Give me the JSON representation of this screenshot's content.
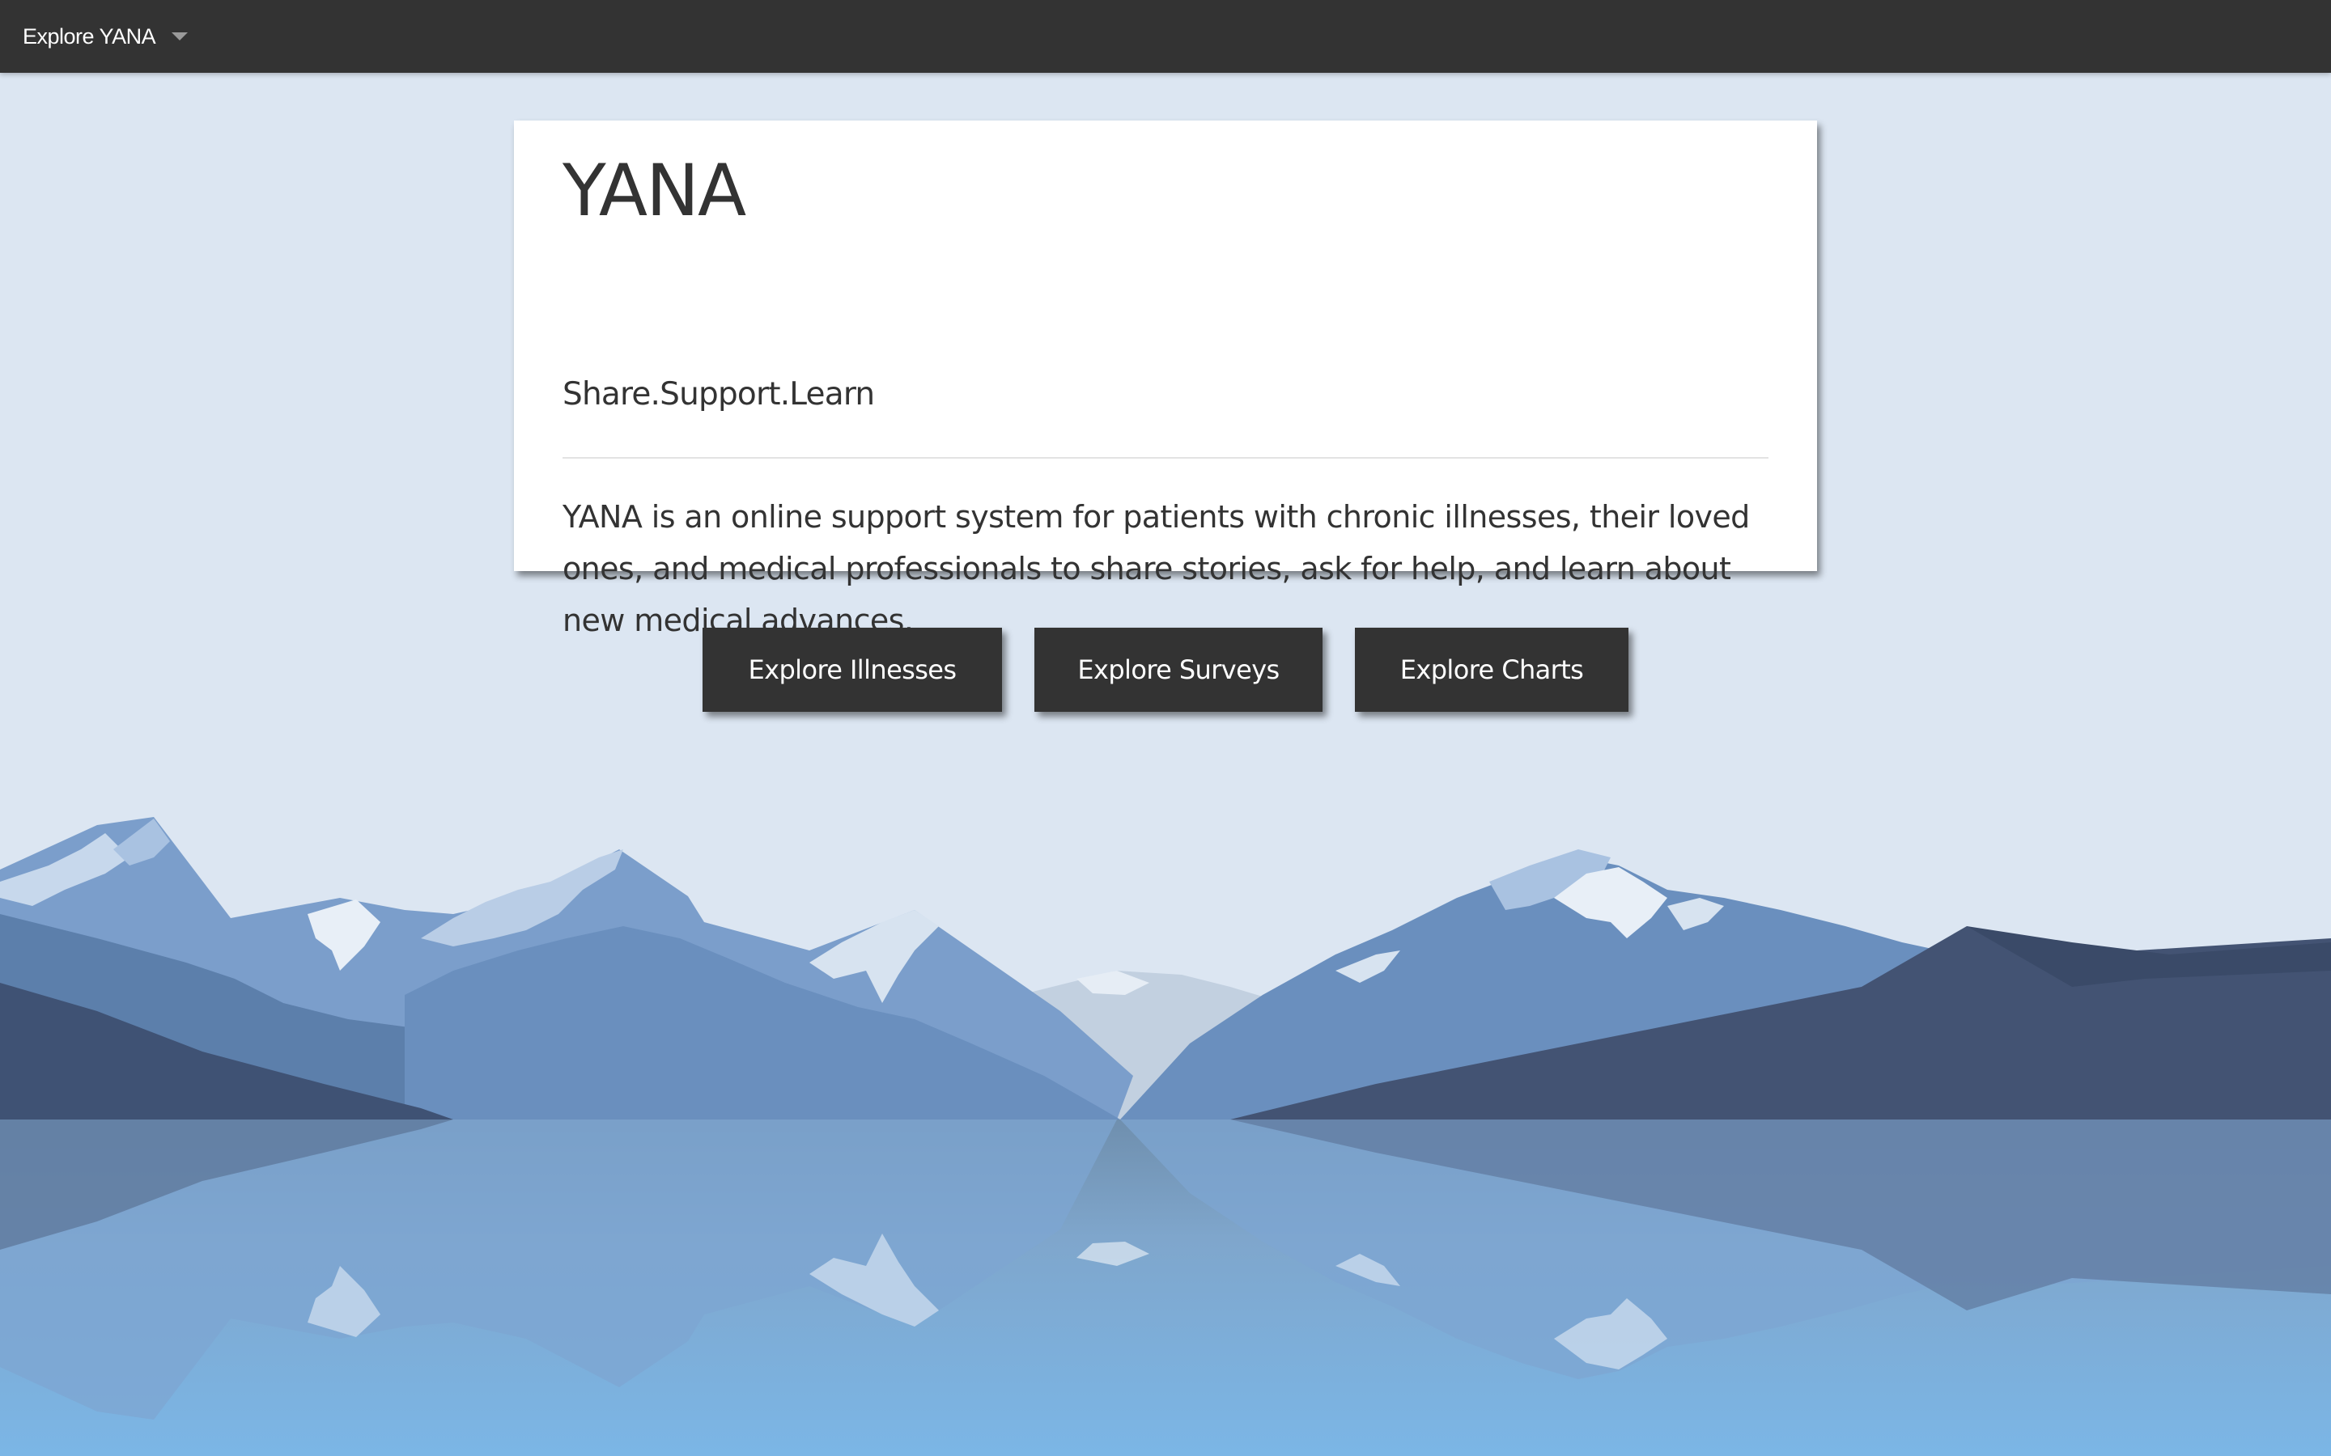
{
  "navbar": {
    "menu_label": "Explore YANA",
    "caret_icon": "caret-down-icon"
  },
  "hero": {
    "title": "YANA",
    "tagline": "Share.Support.Learn",
    "description": "YANA is an online support system for patients with chronic illnesses, their loved ones, and medical professionals to share stories, ask for help, and learn about new medical advances."
  },
  "actions": {
    "illnesses_label": "Explore Illnesses",
    "surveys_label": "Explore Surveys",
    "charts_label": "Explore Charts"
  },
  "colors": {
    "navbar": "#333333",
    "sky": "#dce6f2",
    "card": "#ffffff",
    "button": "#333333",
    "text": "#333333"
  }
}
